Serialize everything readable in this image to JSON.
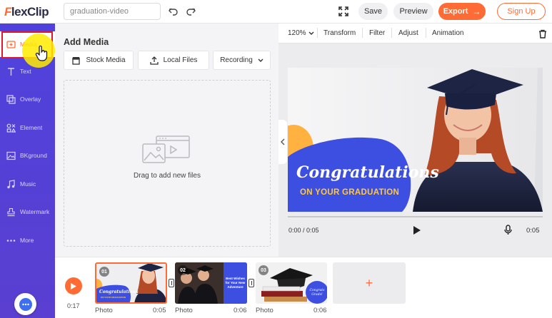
{
  "app": {
    "logo_first": "F",
    "logo_rest": "lexClip"
  },
  "topbar": {
    "project_name": "graduation-video",
    "save_label": "Save",
    "preview_label": "Preview",
    "export_label": "Export",
    "signup_label": "Sign Up"
  },
  "sidebar": {
    "items": [
      {
        "label": "Media",
        "icon": "media-icon",
        "active": true
      },
      {
        "label": "Text",
        "icon": "text-icon"
      },
      {
        "label": "Overlay",
        "icon": "overlay-icon"
      },
      {
        "label": "Element",
        "icon": "element-icon"
      },
      {
        "label": "BKground",
        "icon": "background-icon"
      },
      {
        "label": "Music",
        "icon": "music-icon"
      },
      {
        "label": "Watermark",
        "icon": "watermark-icon"
      },
      {
        "label": "More",
        "icon": "more-icon"
      }
    ]
  },
  "media_panel": {
    "title": "Add Media",
    "tabs": {
      "stock": "Stock Media",
      "local": "Local Files",
      "recording": "Recording"
    },
    "drop_label": "Drag to add new files"
  },
  "canvas_toolbar": {
    "zoom": "120%",
    "transform": "Transform",
    "filter": "Filter",
    "adjust": "Adjust",
    "animation": "Animation"
  },
  "preview": {
    "headline": "Congratulations",
    "subline": "ON YOUR GRADUATION",
    "time_current": "0:00 / 0:05",
    "time_end": "0:05"
  },
  "timeline": {
    "total_time": "0:17",
    "clips": [
      {
        "num": "01",
        "type": "Photo",
        "duration": "0:05"
      },
      {
        "num": "02",
        "type": "Photo",
        "duration": "0:06"
      },
      {
        "num": "03",
        "type": "Photo",
        "duration": "0:06"
      }
    ],
    "clip2_text": "Best Wishes for Your New Adventure",
    "clip3_text": "Congrats Grads!"
  },
  "colors": {
    "accent": "#ff6b35",
    "sidebar": "#4f42dc",
    "preview_blue": "#3d4fe0",
    "preview_yellow": "#ffb23f",
    "preview_text_yellow": "#ffc93c"
  }
}
